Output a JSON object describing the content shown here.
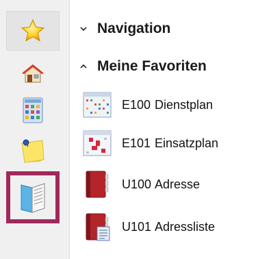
{
  "sidebar": {
    "items": [
      {
        "icon": "star-icon"
      },
      {
        "icon": "home-icon"
      },
      {
        "icon": "calendar-grid-icon"
      },
      {
        "icon": "sticky-note-icon"
      },
      {
        "icon": "open-book-icon"
      }
    ],
    "selected_index": 4,
    "accent": "#a0295b"
  },
  "navigation": {
    "label": "Navigation",
    "expanded": false
  },
  "favorites": {
    "label": "Meine Favoriten",
    "expanded": true,
    "items": [
      {
        "code": "E100",
        "label": "Dienstplan",
        "icon": "schedule-plan-icon"
      },
      {
        "code": "E101",
        "label": "Einsatzplan",
        "icon": "assignment-plan-icon"
      },
      {
        "code": "U100",
        "label": "Adresse",
        "icon": "address-book-icon"
      },
      {
        "code": "U101",
        "label": "Adressliste",
        "icon": "address-list-icon"
      }
    ]
  }
}
